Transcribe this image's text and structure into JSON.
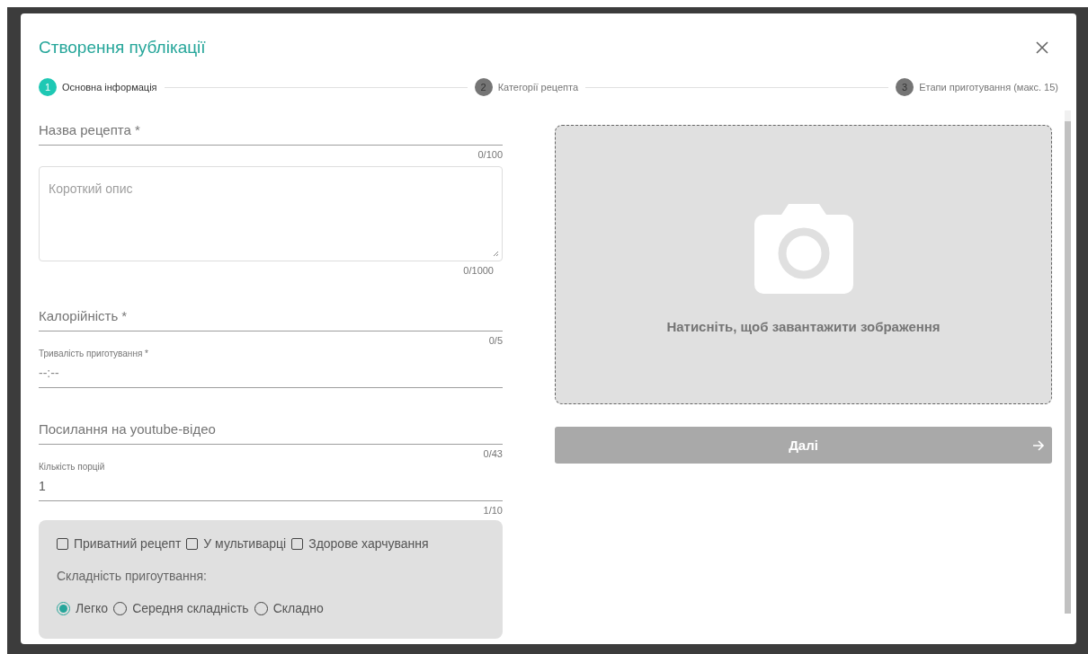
{
  "dialog": {
    "title": "Створення публікації"
  },
  "steps": [
    {
      "number": "1",
      "label": "Основна інформація",
      "selected": true
    },
    {
      "number": "2",
      "label": "Категорії рецепта",
      "selected": false
    },
    {
      "number": "3",
      "label": "Етапи приготування (макс. 15)",
      "selected": false
    }
  ],
  "fields": [
    {
      "kind": "line",
      "placeholder": "Назва рецепта *",
      "counter": "0/100"
    },
    {
      "kind": "area",
      "placeholder": "Короткий опис",
      "counter": "0/1000"
    },
    {
      "kind": "line",
      "placeholder": "Калорійність *",
      "counter": "0/5"
    },
    {
      "kind": "labeled",
      "label": "Тривалість приготування *",
      "value": "--:--"
    },
    {
      "kind": "line",
      "placeholder": "Посилання на youtube-відео",
      "counter": "0/43"
    },
    {
      "kind": "labeled",
      "label": "Кількість порцій",
      "value": "1",
      "counter": "1/10"
    }
  ],
  "options": {
    "checkboxes": [
      {
        "label": "Приватний рецепт",
        "checked": false
      },
      {
        "label": "У мультиварці",
        "checked": false
      },
      {
        "label": "Здорове харчування",
        "checked": false
      }
    ],
    "difficulty_label": "Складність пригоутвання:",
    "difficulty": [
      {
        "label": "Легко",
        "selected": true
      },
      {
        "label": "Середня складність",
        "selected": false
      },
      {
        "label": "Складно",
        "selected": false
      }
    ]
  },
  "upload": {
    "text": "Натисніть, щоб завантажити зображення"
  },
  "next_button": {
    "label": "Далі",
    "disabled": true
  }
}
